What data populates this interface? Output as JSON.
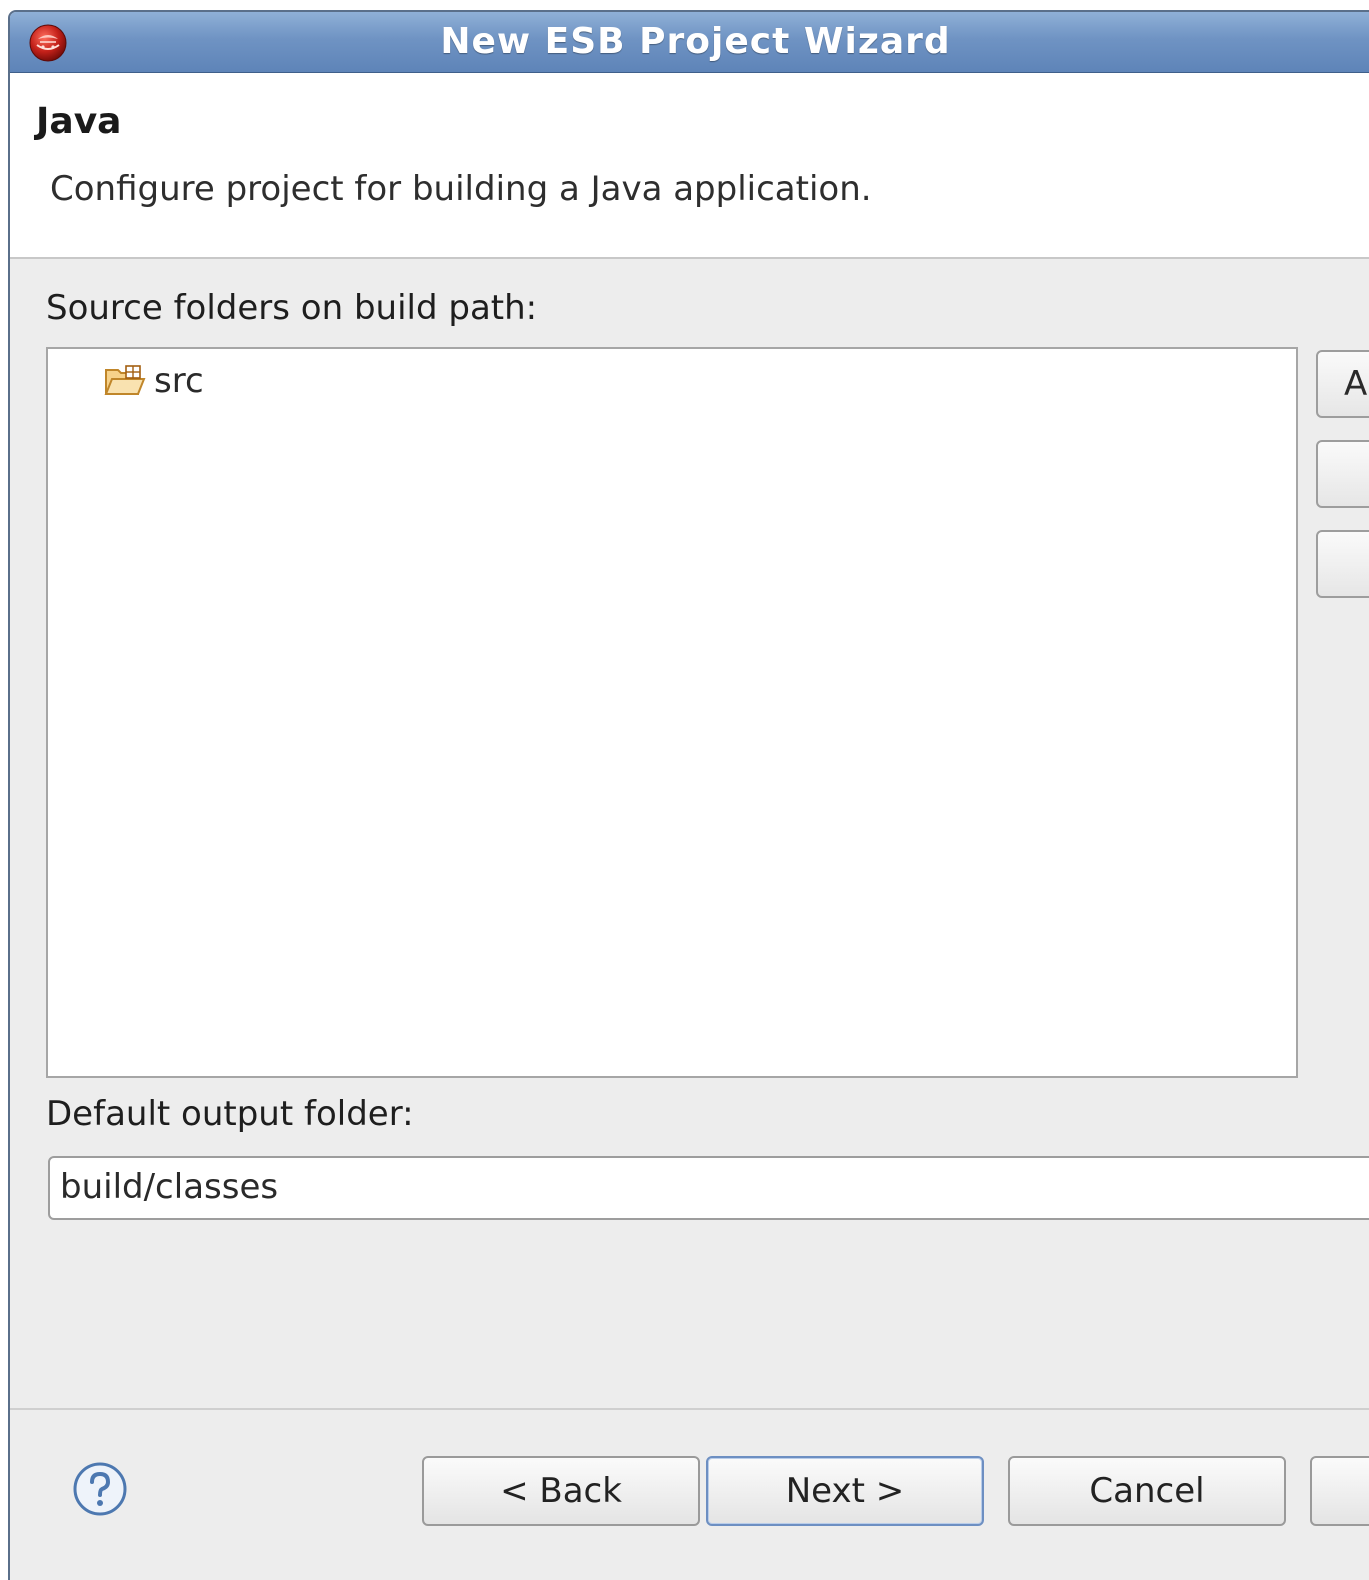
{
  "window": {
    "title": "New ESB Project Wizard",
    "app_icon": "eclipse-red-icon"
  },
  "header": {
    "title": "Java",
    "description": "Configure project for building a Java application."
  },
  "source_folders": {
    "label": "Source folders on build path:",
    "items": [
      {
        "icon": "source-folder-icon",
        "label": "src"
      }
    ],
    "side_buttons": [
      {
        "label": "A"
      },
      {
        "label": ""
      },
      {
        "label": ""
      }
    ]
  },
  "output": {
    "label": "Default output folder:",
    "value": "build/classes"
  },
  "footer": {
    "help_icon": "help-icon",
    "back_label": "< Back",
    "next_label": "Next >",
    "cancel_label": "Cancel",
    "finish_label": ""
  },
  "colors": {
    "titlebar": "#6f93c3",
    "dialog_bg": "#ededed",
    "default_button_border": "#6d8fc2"
  }
}
